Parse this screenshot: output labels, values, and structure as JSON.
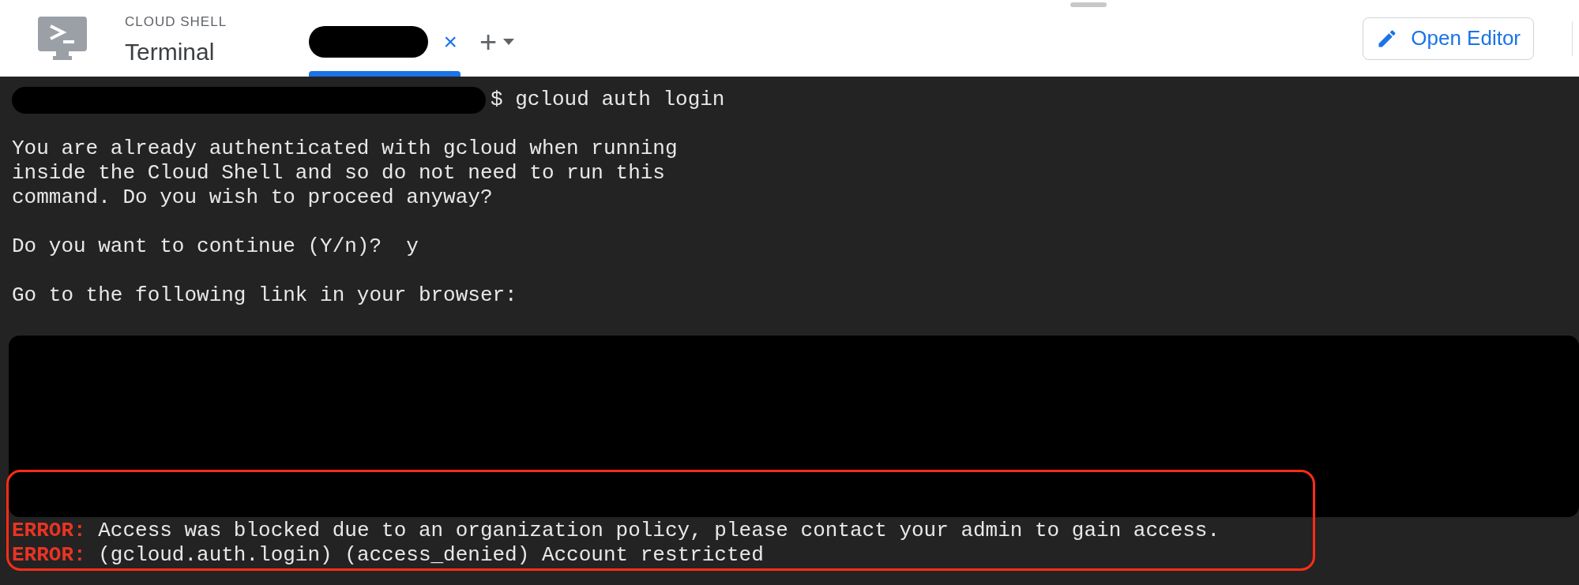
{
  "header": {
    "product": "CLOUD SHELL",
    "title": "Terminal"
  },
  "tabs": [
    {
      "selected": true,
      "close": "×"
    }
  ],
  "add_tab": {
    "label": "+"
  },
  "open_editor": {
    "label": "Open Editor"
  },
  "terminal": {
    "lines": [
      {
        "kind": "prompt",
        "command": "$ gcloud auth login"
      },
      {
        "kind": "blank"
      },
      {
        "kind": "output",
        "text": "You are already authenticated with gcloud when running"
      },
      {
        "kind": "output",
        "text": "inside the Cloud Shell and so do not need to run this"
      },
      {
        "kind": "output",
        "text": "command. Do you wish to proceed anyway?"
      },
      {
        "kind": "blank"
      },
      {
        "kind": "output",
        "text": "Do you want to continue (Y/n)?  y"
      },
      {
        "kind": "blank"
      },
      {
        "kind": "output",
        "text": "Go to the following link in your browser:"
      },
      {
        "kind": "blank"
      },
      {
        "kind": "redacted"
      }
    ],
    "highlighted_lines": [
      {
        "kind": "error",
        "label": "ERROR:",
        "text": "Access was blocked due to an organization policy, please contact your admin to gain access."
      },
      {
        "kind": "error",
        "label": "ERROR:",
        "text": "(gcloud.auth.login) (access_denied) Account restricted"
      }
    ]
  }
}
